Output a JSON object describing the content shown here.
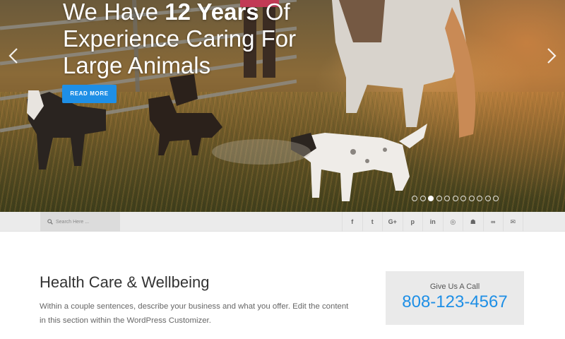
{
  "hero": {
    "headline": {
      "part1": "We Have ",
      "bold": "12 Years",
      "part2": " Of Experience Caring For Large Animals"
    },
    "cta_label": "READ MORE",
    "slides_total": 11,
    "active_slide": 3,
    "icons": {
      "prev": "chevron-left-icon",
      "next": "chevron-right-icon"
    }
  },
  "toolbar": {
    "search_placeholder": "Search Here ...",
    "social": [
      {
        "name": "facebook",
        "glyph": "f"
      },
      {
        "name": "twitter",
        "glyph": "t"
      },
      {
        "name": "google-plus",
        "glyph": "G+"
      },
      {
        "name": "pinterest",
        "glyph": "p"
      },
      {
        "name": "linkedin",
        "glyph": "in"
      },
      {
        "name": "dribbble",
        "glyph": "◎"
      },
      {
        "name": "github",
        "glyph": "☗"
      },
      {
        "name": "link",
        "glyph": "∞"
      },
      {
        "name": "email",
        "glyph": "✉"
      }
    ]
  },
  "content": {
    "title": "Health Care & Wellbeing",
    "body": "Within a couple sentences, describe your business and what you offer. Edit the content in this section within the WordPress Customizer."
  },
  "call": {
    "label": "Give Us A Call",
    "phone": "808-123-4567"
  },
  "colors": {
    "accent": "#1e8fe6",
    "toolbar_bg": "#ebebeb",
    "call_box_bg": "#eaeaea"
  }
}
